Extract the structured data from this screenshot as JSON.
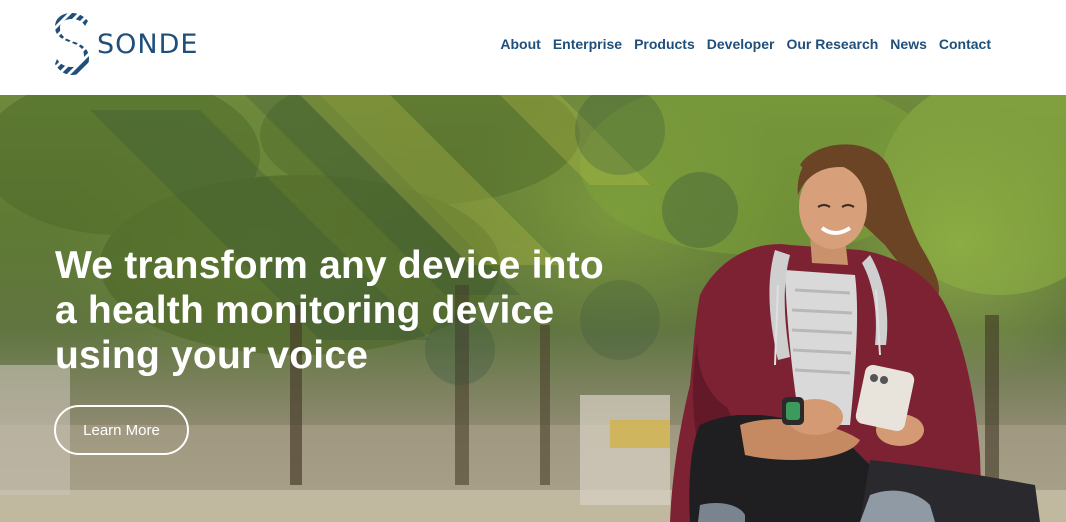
{
  "brand": {
    "name": "SONDE",
    "logo_icon": "sonde-s-mark-icon",
    "color": "#1f4f7a"
  },
  "nav": {
    "items": [
      {
        "label": "About"
      },
      {
        "label": "Enterprise"
      },
      {
        "label": "Products"
      },
      {
        "label": "Developer"
      },
      {
        "label": "Our Research"
      },
      {
        "label": "News"
      },
      {
        "label": "Contact"
      }
    ]
  },
  "hero": {
    "headline_lines": [
      "We transform any device into",
      "a health monitoring device",
      "using your voice"
    ],
    "cta_label": "Learn More",
    "image": "woman-with-smartphone-photo"
  }
}
